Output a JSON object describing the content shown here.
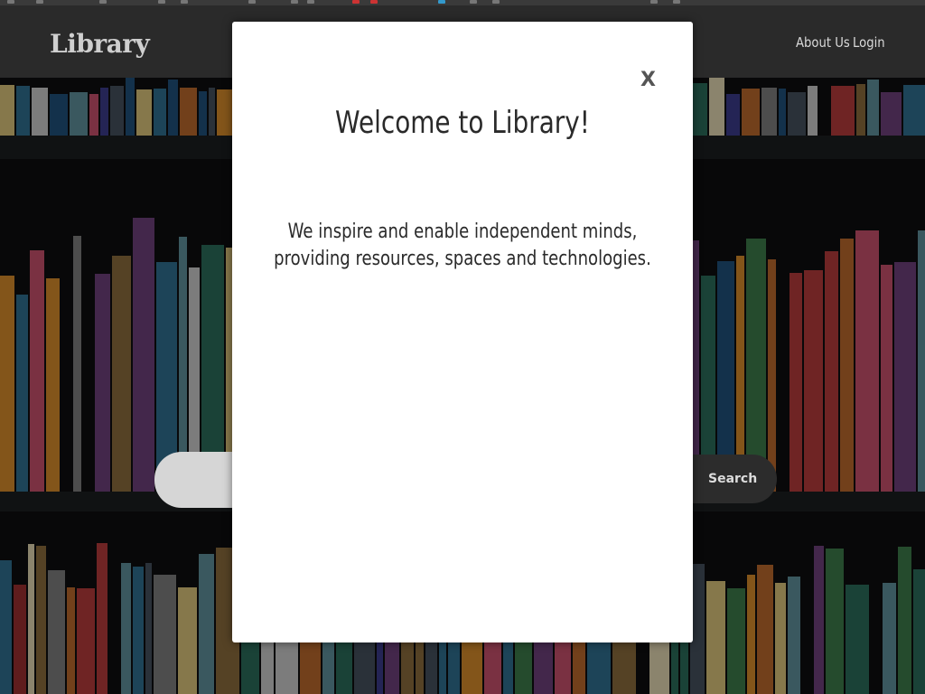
{
  "navbar": {
    "brand": "Library",
    "links": [
      "About Us",
      "Login"
    ]
  },
  "search": {
    "placeholder": "",
    "button_label": "Search"
  },
  "modal": {
    "close_label": "X",
    "title": "Welcome to Library!",
    "body_line1": "We inspire and enable independent minds,",
    "body_line2": "providing resources, spaces and technologies."
  },
  "colors": {
    "navbar": "#2a2a2a",
    "modal_bg": "#ffffff",
    "text": "#2a2a2a"
  }
}
